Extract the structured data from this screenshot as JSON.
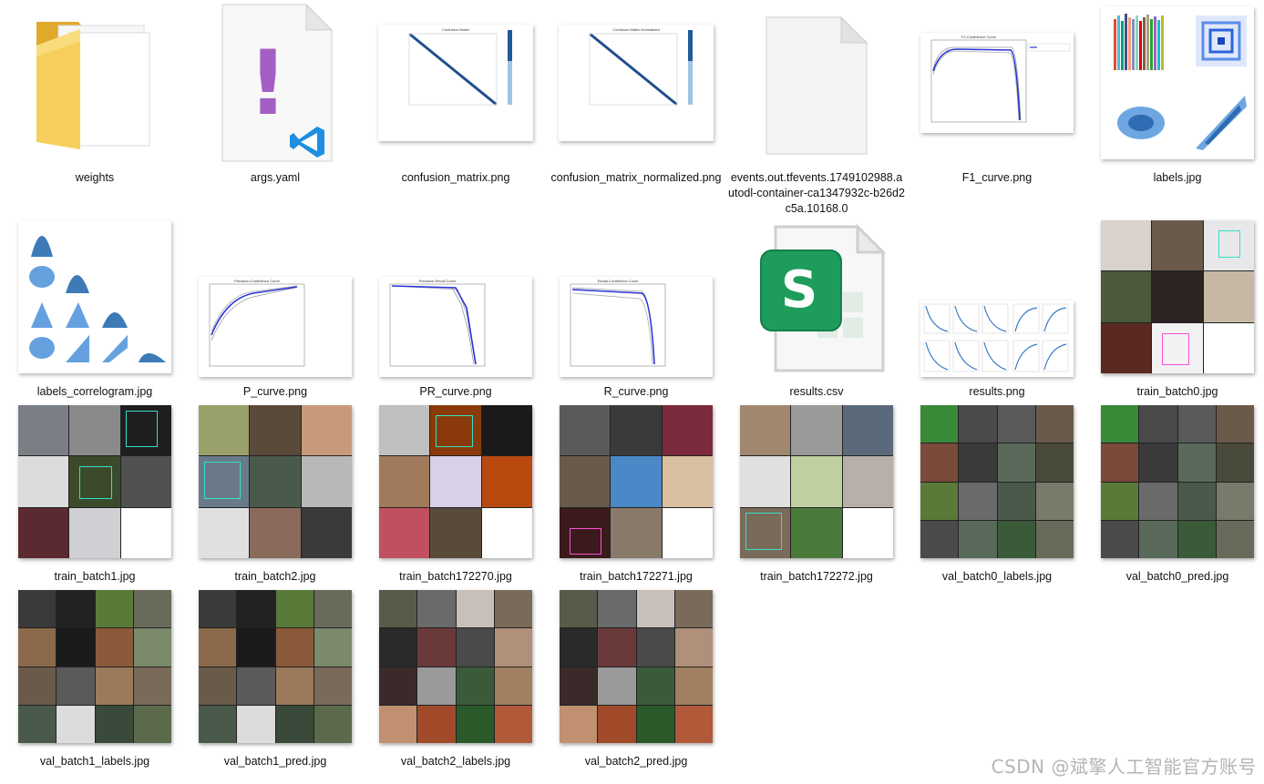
{
  "files": [
    {
      "name": "weights",
      "kind": "folder"
    },
    {
      "name": "args.yaml",
      "kind": "yaml"
    },
    {
      "name": "confusion_matrix.png",
      "kind": "confusion"
    },
    {
      "name": "confusion_matrix_normalized.png",
      "kind": "confusion"
    },
    {
      "name": "events.out.tfevents.1749102988.autodl-container-ca1347932c-b26d2c5a.10168.0",
      "kind": "blank"
    },
    {
      "name": "F1_curve.png",
      "kind": "curve"
    },
    {
      "name": "labels.jpg",
      "kind": "labels"
    },
    {
      "name": "labels_correlogram.jpg",
      "kind": "correlogram"
    },
    {
      "name": "P_curve.png",
      "kind": "curve"
    },
    {
      "name": "PR_curve.png",
      "kind": "pr"
    },
    {
      "name": "R_curve.png",
      "kind": "curve"
    },
    {
      "name": "results.csv",
      "kind": "csv"
    },
    {
      "name": "results.png",
      "kind": "results"
    },
    {
      "name": "train_batch0.jpg",
      "kind": "mosaic"
    },
    {
      "name": "train_batch1.jpg",
      "kind": "mosaic"
    },
    {
      "name": "train_batch2.jpg",
      "kind": "mosaic"
    },
    {
      "name": "train_batch172270.jpg",
      "kind": "mosaic"
    },
    {
      "name": "train_batch172271.jpg",
      "kind": "mosaic"
    },
    {
      "name": "train_batch172272.jpg",
      "kind": "mosaic"
    },
    {
      "name": "val_batch0_labels.jpg",
      "kind": "mosaic"
    },
    {
      "name": "val_batch0_pred.jpg",
      "kind": "mosaic"
    },
    {
      "name": "val_batch1_labels.jpg",
      "kind": "mosaic"
    },
    {
      "name": "val_batch1_pred.jpg",
      "kind": "mosaic"
    },
    {
      "name": "val_batch2_labels.jpg",
      "kind": "mosaic"
    },
    {
      "name": "val_batch2_pred.jpg",
      "kind": "mosaic"
    }
  ],
  "watermark": "CSDN @斌擎人工智能官方账号",
  "icons": {
    "yaml_glyph": "!",
    "csv_glyph": "S"
  },
  "colors": {
    "folder": "#f3c64a",
    "yaml_purple": "#a35fc3",
    "vscode_blue": "#1d8fe0",
    "csv_green": "#1e9c5b",
    "curve_blue": "#2a34d6",
    "plot_blue": "#3b7dc4"
  }
}
